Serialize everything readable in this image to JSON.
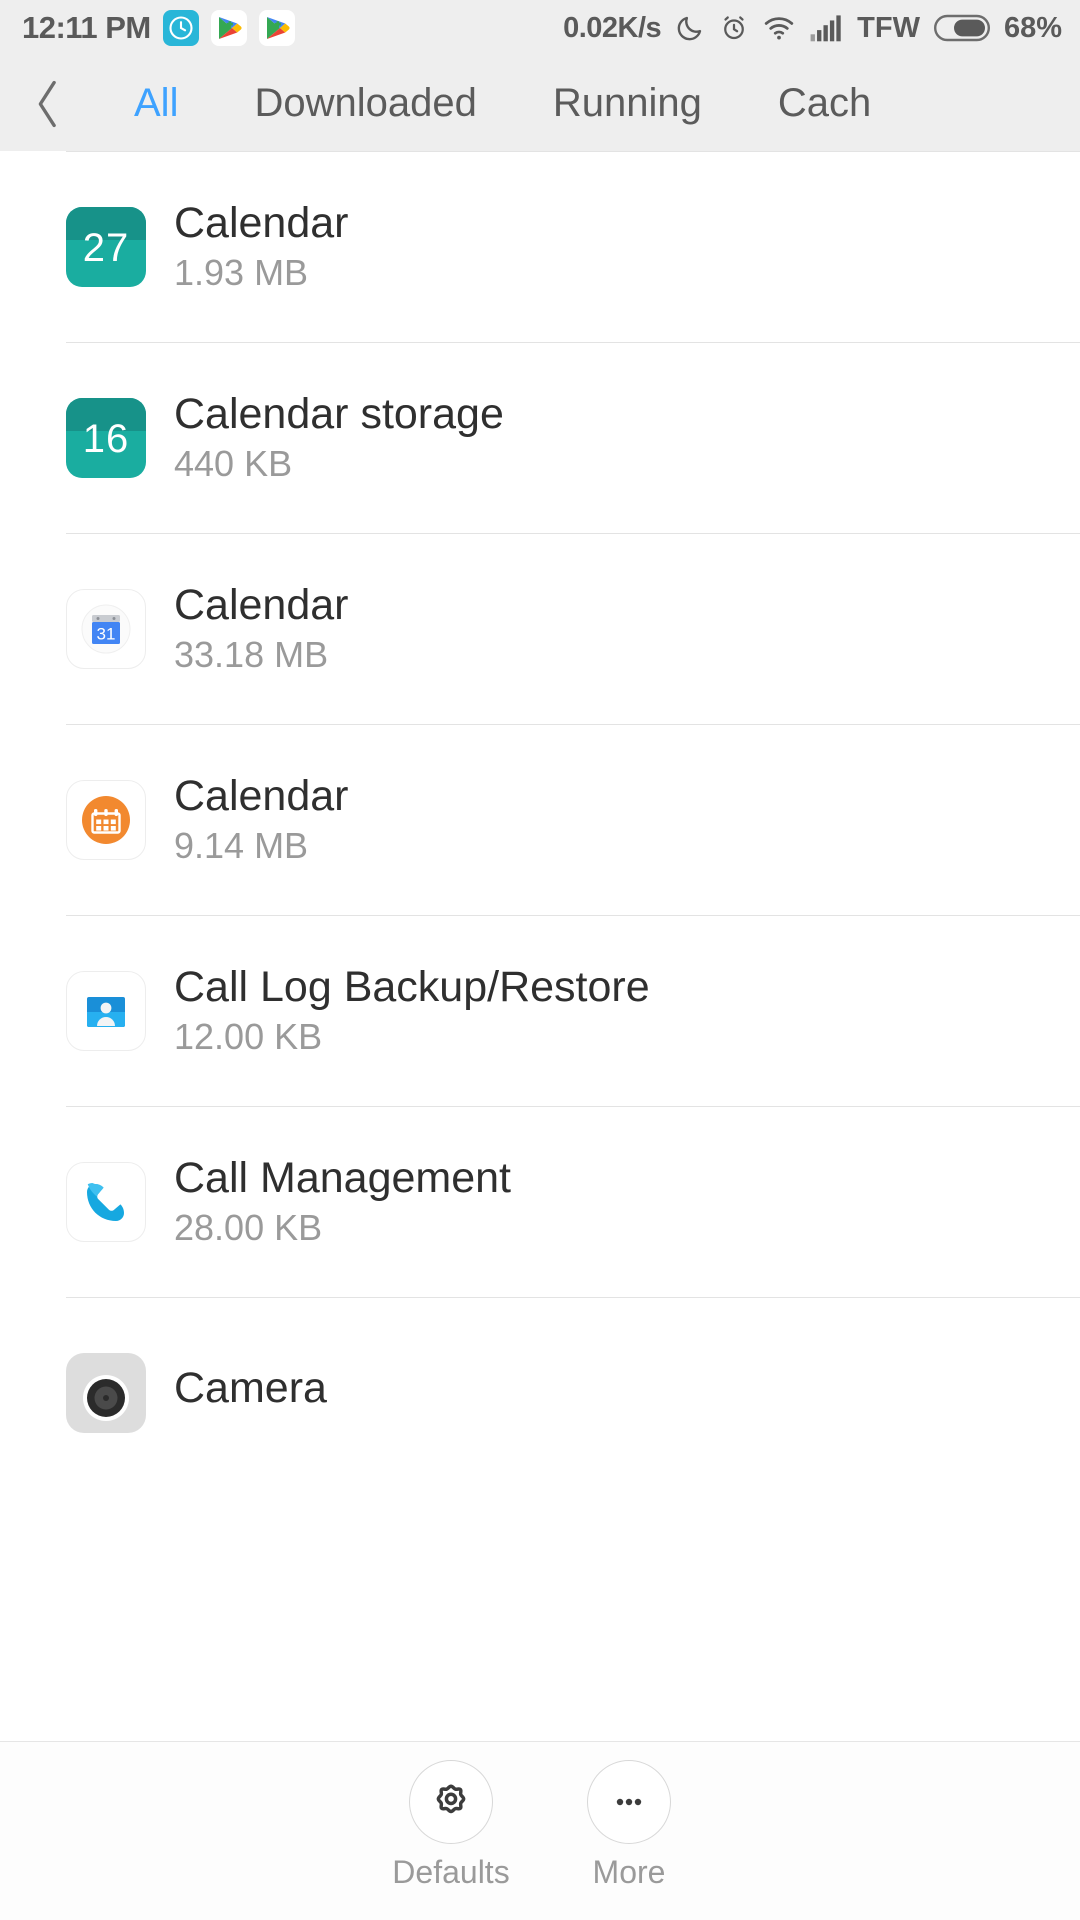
{
  "status_bar": {
    "time": "12:11 PM",
    "network_speed": "0.02K/s",
    "carrier": "TFW",
    "battery_percent": "68%",
    "icons": [
      "clock-app-icon",
      "google-play-services-icon",
      "google-play-services-icon",
      "do-not-disturb-moon-icon",
      "alarm-icon",
      "wifi-icon",
      "cellular-signal-icon",
      "battery-icon"
    ]
  },
  "tab_bar": {
    "back_icon": "chevron-left-icon",
    "tabs": [
      {
        "label": "All",
        "active": true
      },
      {
        "label": "Downloaded",
        "active": false
      },
      {
        "label": "Running",
        "active": false
      },
      {
        "label": "Cach",
        "active": false
      }
    ]
  },
  "app_list": [
    {
      "name": "Calendar",
      "size": "1.93 MB",
      "icon": "calendar-date-27-icon",
      "icon_type": "date",
      "icon_text": "27",
      "icon_color": "#1aada0"
    },
    {
      "name": "Calendar storage",
      "size": "440 KB",
      "icon": "calendar-date-16-icon",
      "icon_type": "date",
      "icon_text": "16",
      "icon_color": "#1aada0"
    },
    {
      "name": "Calendar",
      "size": "33.18 MB",
      "icon": "google-calendar-icon",
      "icon_type": "gcal",
      "icon_text": "31",
      "icon_color": "#4285f4"
    },
    {
      "name": "Calendar",
      "size": "9.14 MB",
      "icon": "orange-calendar-icon",
      "icon_type": "ocal",
      "icon_text": "",
      "icon_color": "#f2892f"
    },
    {
      "name": "Call Log Backup/Restore",
      "size": "12.00 KB",
      "icon": "contacts-card-icon",
      "icon_type": "card",
      "icon_text": "",
      "icon_color": "#1a8fd8"
    },
    {
      "name": "Call Management",
      "size": "28.00 KB",
      "icon": "phone-handset-icon",
      "icon_type": "phone",
      "icon_text": "",
      "icon_color": "#16a8e0"
    },
    {
      "name": "Camera",
      "size": "",
      "icon": "camera-lens-icon",
      "icon_type": "cam",
      "icon_text": "",
      "icon_color": "#2b2b2b"
    }
  ],
  "bottom_bar": {
    "actions": [
      {
        "label": "Defaults",
        "icon": "gear-icon"
      },
      {
        "label": "More",
        "icon": "overflow-dots-icon"
      }
    ]
  },
  "colors": {
    "accent": "#3ea2ff",
    "header_bg": "#eeeeee",
    "title_text": "#2f2f2f",
    "secondary_text": "#9a9a9a"
  }
}
